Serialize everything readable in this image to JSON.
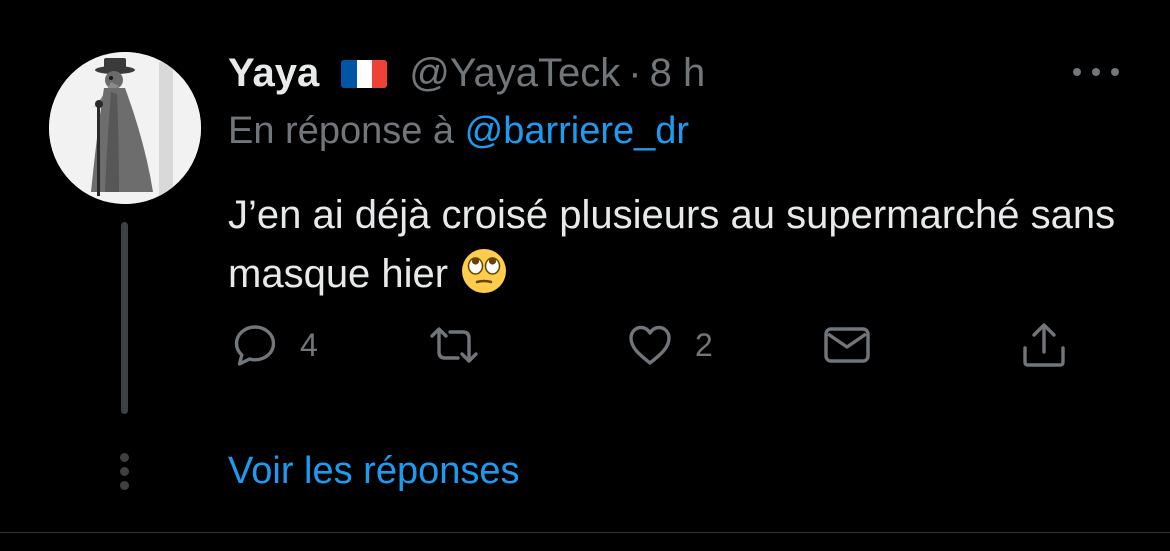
{
  "author": {
    "name": "Yaya",
    "flag": "flag-france",
    "handle": "@YayaTeck",
    "separator": "·",
    "time": "8 h"
  },
  "reply_to": {
    "prefix": "En réponse à",
    "handle": "@barriere_dr"
  },
  "tweet": {
    "text": "J’en ai déjà croisé plusieurs au supermarché sans masque hier",
    "emoji": "face-with-rolling-eyes"
  },
  "actions": {
    "reply_count": "4",
    "retweet_count": "",
    "like_count": "2"
  },
  "thread": {
    "see_replies": "Voir les réponses"
  },
  "colors": {
    "background": "#000000",
    "text": "#e7e9ea",
    "muted": "#71767b",
    "link": "#1d9bf0",
    "thread_line": "#3e4144"
  }
}
